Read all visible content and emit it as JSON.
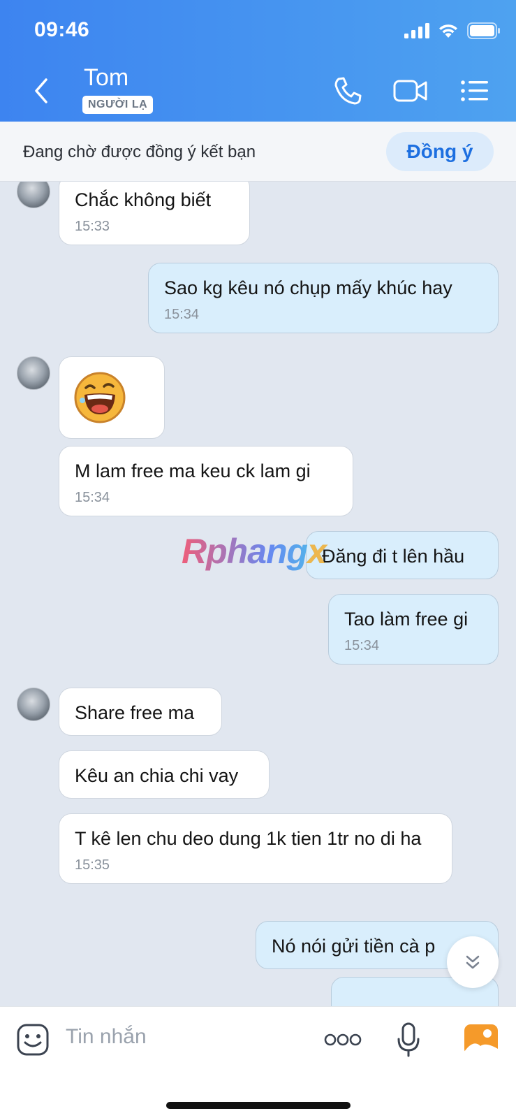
{
  "status_bar": {
    "time": "09:46"
  },
  "header": {
    "contact_name": "Tom",
    "badge": "NGƯỜI LẠ"
  },
  "friend_request": {
    "text": "Đang chờ được đồng ý kết bạn",
    "accept_label": "Đồng ý"
  },
  "messages": [
    {
      "dir": "in",
      "text": "Chắc không biết",
      "time": "15:33"
    },
    {
      "dir": "out",
      "text": "Sao kg kêu nó chụp mấy khúc hay",
      "time": "15:34"
    },
    {
      "dir": "in",
      "sticker": "laughing-face"
    },
    {
      "dir": "in",
      "text": "M lam free ma keu ck lam gi",
      "time": "15:34"
    },
    {
      "dir": "out",
      "text": "Đăng đi t lên hầu"
    },
    {
      "dir": "out",
      "text": "Tao làm free gi",
      "time": "15:34"
    },
    {
      "dir": "in",
      "text": "Share free ma"
    },
    {
      "dir": "in",
      "text": "Kêu an chia chi vay"
    },
    {
      "dir": "in",
      "text": "T kê len chu deo dung 1k tien 1tr no di ha",
      "time": "15:35"
    },
    {
      "dir": "out",
      "text": "Nó nói gửi tiền cà p"
    }
  ],
  "watermark": {
    "text": "Rphang",
    "suffix": "x"
  },
  "input": {
    "placeholder": "Tin nhắn"
  },
  "colors": {
    "header_start": "#3d84f0",
    "header_end": "#4ea2f0",
    "out_bubble": "#d9eefc",
    "in_bubble": "#ffffff",
    "accent": "#1d6fe0"
  }
}
